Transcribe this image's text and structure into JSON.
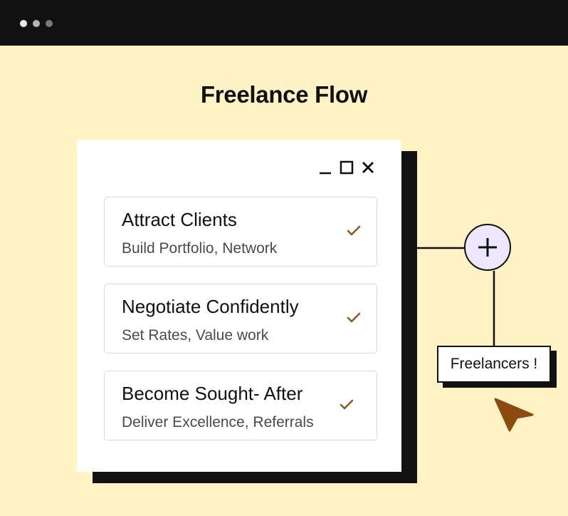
{
  "window": {
    "traffic_lights": [
      "dot-light",
      "dot-mid",
      "dot-dark"
    ]
  },
  "page": {
    "title": "Freelance Flow"
  },
  "panel": {
    "controls": [
      "minimize-icon",
      "maximize-icon",
      "close-icon"
    ],
    "cards": [
      {
        "title": "Attract Clients",
        "subtitle": "Build Portfolio, Network",
        "icon": "check-icon"
      },
      {
        "title": "Negotiate Confidently",
        "subtitle": "Set Rates, Value work",
        "icon": "check-icon"
      },
      {
        "title": "Become Sought- After",
        "subtitle": "Deliver Excellence, Referrals",
        "icon": "check-icon"
      }
    ]
  },
  "node": {
    "icon": "plus-icon",
    "label": "Freelancers !"
  },
  "cursor_icon": "cursor-arrow-icon",
  "colors": {
    "background": "#fff3c6",
    "topbar": "#111111",
    "check": "#8a5a1a",
    "cursor": "#8b4a0e",
    "plus_fill": "#ece6ff"
  }
}
